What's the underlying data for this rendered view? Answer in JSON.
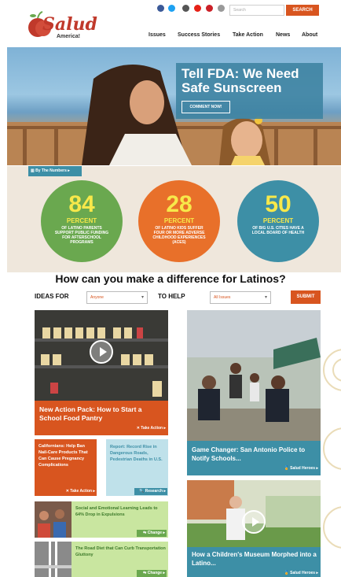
{
  "header": {
    "logo_text": "Salud",
    "logo_sub": "America!",
    "search_placeholder": "Search",
    "search_button": "SEARCH",
    "social_icons": [
      "facebook-icon",
      "twitter-icon",
      "instagram-icon",
      "youtube-icon",
      "pinterest-icon",
      "email-icon"
    ],
    "nav": [
      "Issues",
      "Success Stories",
      "Take Action",
      "News",
      "About"
    ]
  },
  "hero": {
    "title": "Tell FDA: We Need Safe Sunscreen",
    "button": "COMMENT NOW!"
  },
  "stats": {
    "tab": "By The Numbers",
    "items": [
      {
        "number": "84",
        "unit": "PERCENT",
        "desc": "OF LATINO PARENTS SUPPORT PUBLIC FUNDING FOR AFTERSCHOOL PROGRAMS",
        "color": "#6aa84f"
      },
      {
        "number": "28",
        "unit": "PERCENT",
        "desc": "OF LATINO KIDS SUFFER FOUR OR MORE ADVERSE CHILDHOOD EXPERIENCES (ACES)",
        "color": "#e8702a"
      },
      {
        "number": "50",
        "unit": "PERCENT",
        "desc": "OF BIG U.S. CITIES HAVE A LOCAL BOARD OF HEALTH",
        "color": "#3d8fa6"
      }
    ]
  },
  "filter": {
    "headline": "How can you make a difference for Latinos?",
    "ideas_label": "IDEAS FOR",
    "ideas_value": "Anyone",
    "help_label": "TO HELP",
    "help_value": "All Issues",
    "submit": "SUBMIT"
  },
  "cards": {
    "food": {
      "title": "New Action Pack: How to Start a School Food Pantry",
      "tag": "Take Action"
    },
    "police": {
      "title": "Game Changer: San Antonio Police to Notify Schools...",
      "tag": "Salud Heroes"
    },
    "nailcare": {
      "title": "Californians: Help Ban Nail-Care Products That Can Cause Pregnancy Complications",
      "tag": "Take Action"
    },
    "roads": {
      "title": "Report: Record Rise in Dangerous Roads, Pedestrian Deaths in U.S.",
      "tag": "Research"
    },
    "social": {
      "title": "Social and Emotional Learning Leads to 64% Drop in Expulsions",
      "tag": "Change"
    },
    "diet": {
      "title": "The Road Diet that Can Curb Transportation Gluttony",
      "tag": "Change"
    },
    "museum": {
      "title": "How a Children's Museum Morphed into a Latino...",
      "tag": "Salud Heroes"
    }
  }
}
